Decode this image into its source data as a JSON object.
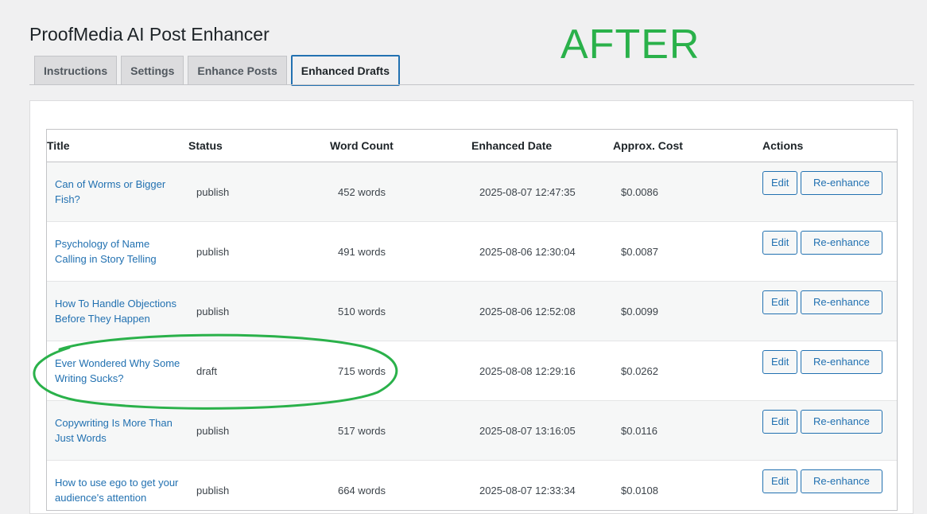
{
  "page": {
    "title": "ProofMedia AI Post Enhancer",
    "annotation_text": "AFTER"
  },
  "tabs": [
    {
      "label": "Instructions",
      "active": false
    },
    {
      "label": "Settings",
      "active": false
    },
    {
      "label": "Enhance Posts",
      "active": false
    },
    {
      "label": "Enhanced Drafts",
      "active": true
    }
  ],
  "table": {
    "headers": [
      "Title",
      "Status",
      "Word Count",
      "Enhanced Date",
      "Approx. Cost",
      "Actions"
    ],
    "rows": [
      {
        "title": "Can of Worms or Bigger Fish?",
        "status": "publish",
        "word_count": "452 words",
        "date": "2025-08-07 12:47:35",
        "cost": "$0.0086",
        "edit": "Edit",
        "reenhance": "Re-enhance"
      },
      {
        "title": "Psychology of Name Calling in Story Telling",
        "status": "publish",
        "word_count": "491 words",
        "date": "2025-08-06 12:30:04",
        "cost": "$0.0087",
        "edit": "Edit",
        "reenhance": "Re-enhance"
      },
      {
        "title": "How To Handle Objections Before They Happen",
        "status": "publish",
        "word_count": "510 words",
        "date": "2025-08-06 12:52:08",
        "cost": "$0.0099",
        "edit": "Edit",
        "reenhance": "Re-enhance"
      },
      {
        "title": "Ever Wondered Why Some Writing Sucks?",
        "status": "draft",
        "word_count": "715 words",
        "date": "2025-08-08 12:29:16",
        "cost": "$0.0262",
        "edit": "Edit",
        "reenhance": "Re-enhance"
      },
      {
        "title": "Copywriting Is More Than Just Words",
        "status": "publish",
        "word_count": "517 words",
        "date": "2025-08-07 13:16:05",
        "cost": "$0.0116",
        "edit": "Edit",
        "reenhance": "Re-enhance"
      },
      {
        "title": "How to use ego to get your audience's attention",
        "status": "publish",
        "word_count": "664 words",
        "date": "2025-08-07 12:33:34",
        "cost": "$0.0108",
        "edit": "Edit",
        "reenhance": "Re-enhance"
      }
    ]
  },
  "colors": {
    "accent": "#2271b1",
    "annotation_green": "#2ab14a"
  }
}
